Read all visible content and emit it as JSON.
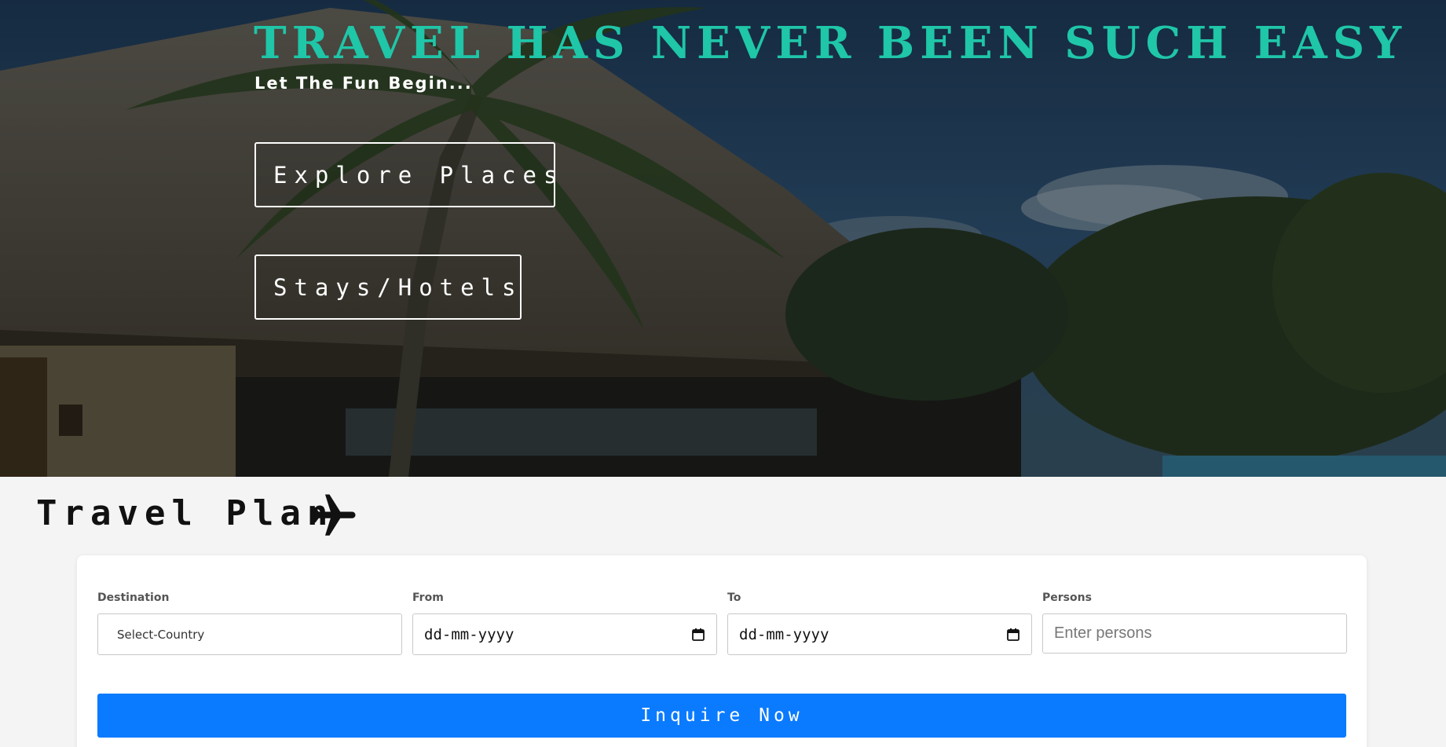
{
  "hero": {
    "title": "TRAVEL HAS NEVER BEEN SUCH EASY",
    "subtitle": "Let The Fun Begin...",
    "buttons": {
      "explore": "Explore Places",
      "stays": "Stays/Hotels"
    },
    "title_color": "#1fc6a8"
  },
  "plan": {
    "title": "Travel Plan",
    "icon": "airplane-icon",
    "fields": {
      "destination": {
        "label": "Destination",
        "value": "Select-Country"
      },
      "from": {
        "label": "From",
        "value": "dd-mm-yyyy"
      },
      "to": {
        "label": "To",
        "value": "dd-mm-yyyy"
      },
      "persons": {
        "label": "Persons",
        "placeholder": "Enter persons"
      }
    },
    "submit_label": "Inquire Now",
    "submit_color": "#0a7bff"
  }
}
